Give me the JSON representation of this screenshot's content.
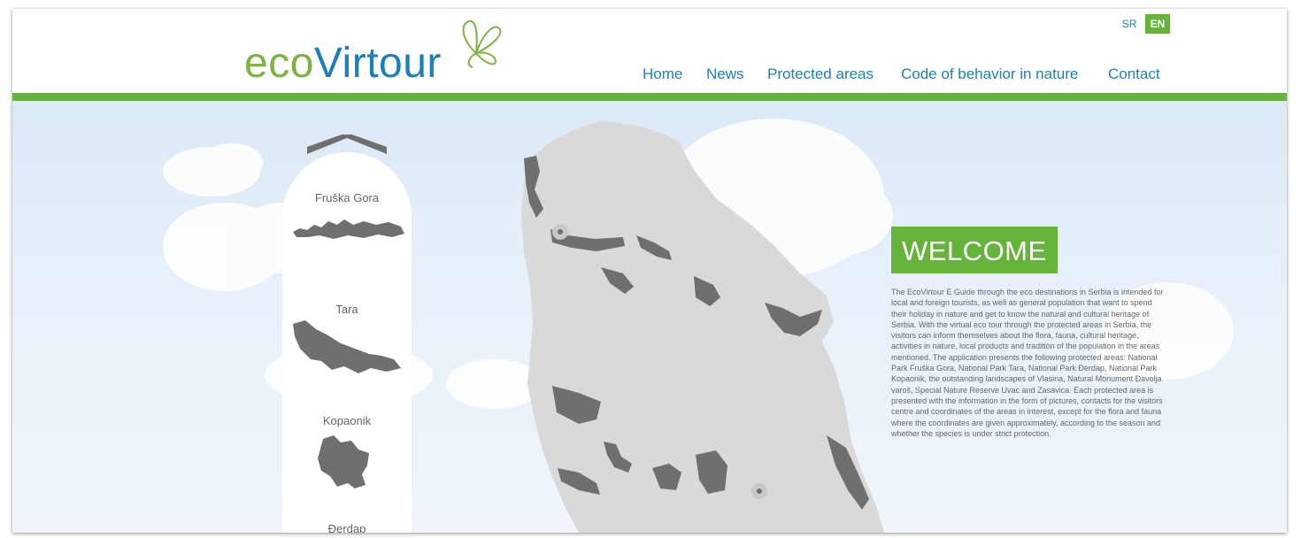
{
  "header": {
    "logo": {
      "part1": "eco",
      "part2": "Virtour"
    },
    "languages": {
      "sr": "SR",
      "en": "EN"
    },
    "nav": [
      "Home",
      "News",
      "Protected areas",
      "Code of behavior in nature",
      "Contact"
    ]
  },
  "sidebar": {
    "items": [
      {
        "label": "Fruška Gora"
      },
      {
        "label": "Tara"
      },
      {
        "label": "Kopaonik"
      },
      {
        "label": "Đerdap"
      }
    ]
  },
  "welcome": {
    "title": "WELCOME",
    "text": "The EcoVirtour E Guide through the eco destinations in Serbia is intended for local and foreign tourists, as well as general population that want to spend their holiday in nature and get to know the natural and cultural heritage of Serbia. With the virtual eco tour through the protected areas in Serbia, the visitors can inform themselves about the flora, fauna, cultural heritage, activities in nature, local products and tradition of the population in the areas mentioned. The application presents the following protected areas: National Park Fruška Gora, National Park Tara, National Park Đerdap, National Park Kopaonik, the outstanding landscapes of Vlasina, Natural Monument Đavolja varoš, Special Nature Reserve Uvac and Zasavica. Each protected area is presented with the information in the form of pictures, contacts for the visitors centre and coordinates of the areas in interest, except for the flora and fauna where the coordinates are given approximately, according to the season and whether the species is under strict protection."
  },
  "colors": {
    "brand_green": "#66b33b",
    "brand_blue": "#1e7fb8",
    "map_fill": "#d9d9d9",
    "region_fill": "#6f6f6f"
  },
  "icons": [
    "butterfly-logo-icon",
    "chevron-up-icon",
    "map-marker-icon"
  ]
}
